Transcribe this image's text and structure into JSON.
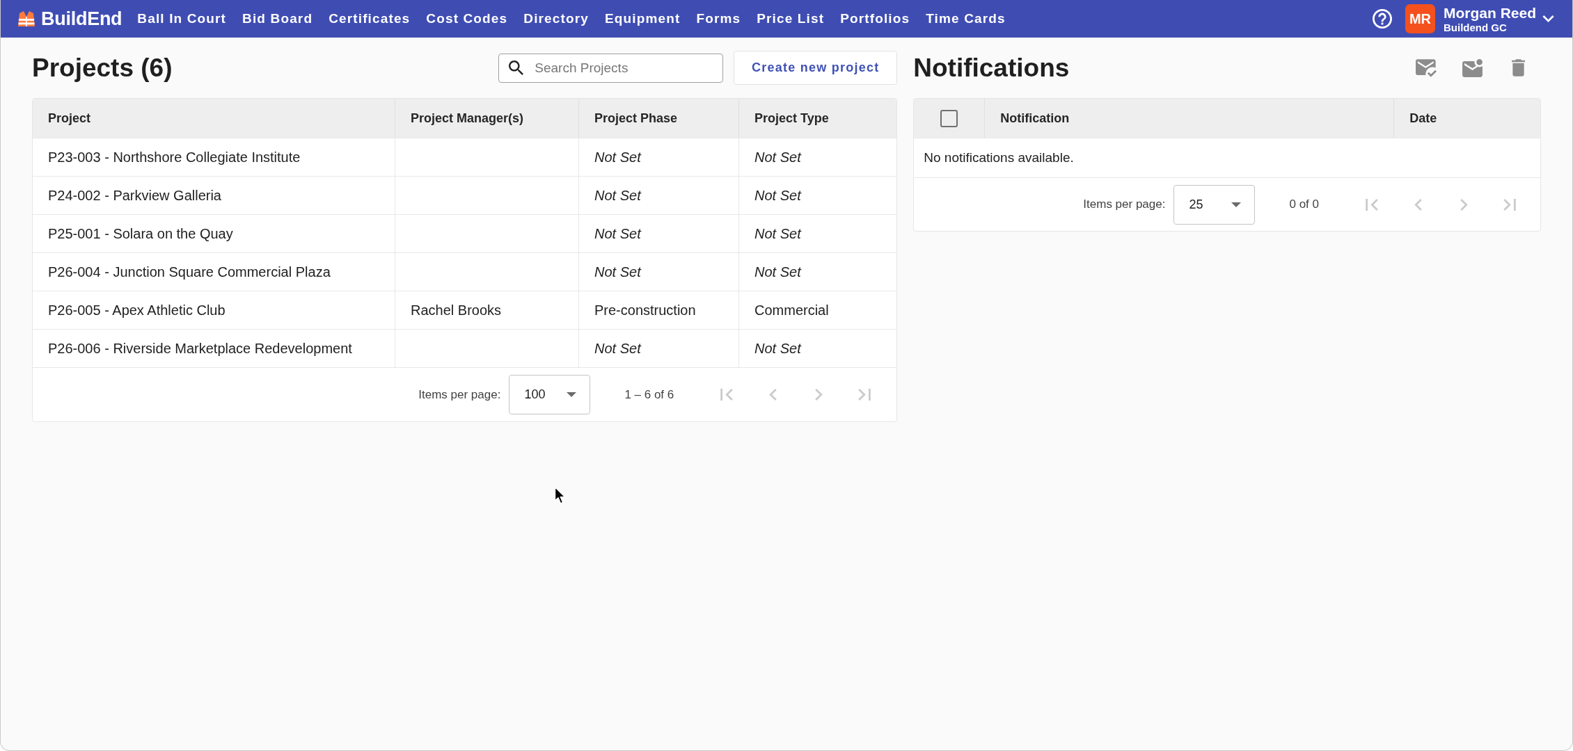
{
  "nav_bar": {
    "logo": "BuildEnd",
    "items": [
      "Ball In Court",
      "Bid Board",
      "Certificates",
      "Cost Codes",
      "Directory",
      "Equipment",
      "Forms",
      "Price List",
      "Portfolios",
      "Time Cards"
    ],
    "user": {
      "initials": "MR",
      "name": "Morgan Reed",
      "company": "Buildend GC"
    }
  },
  "projects": {
    "title": "Projects (6)",
    "search": {
      "placeholder": "Search Projects"
    },
    "create_button": "Create new project",
    "table": {
      "columns": [
        "Project",
        "Project Manager(s)",
        "Project Phase",
        "Project Type"
      ],
      "rows": [
        {
          "project": "P23-003 - Northshore Collegiate Institute",
          "phase": {
            "text": "Not Set",
            "set": false
          },
          "type": {
            "text": "Not Set",
            "set": false
          }
        },
        {
          "project": "P24-002 - Parkview Galleria",
          "phase": {
            "text": "Not Set",
            "set": false
          },
          "type": {
            "text": "Not Set",
            "set": false
          }
        },
        {
          "project": "P25-001 - Solara on the Quay",
          "phase": {
            "text": "Not Set",
            "set": false
          },
          "type": {
            "text": "Not Set",
            "set": false
          }
        },
        {
          "project": "P26-004 - Junction Square Commercial Plaza",
          "phase": {
            "text": "Not Set",
            "set": false
          },
          "type": {
            "text": "Not Set",
            "set": false
          }
        },
        {
          "project": "P26-005 - Apex Athletic Club",
          "manager": "Rachel Brooks",
          "phase": {
            "text": "Pre-construction",
            "set": true
          },
          "type": {
            "text": "Commercial",
            "set": true
          }
        },
        {
          "project": "P26-006 - Riverside Marketplace Redevelopment",
          "phase": {
            "text": "Not Set",
            "set": false
          },
          "type": {
            "text": "Not Set",
            "set": false
          }
        }
      ]
    },
    "pagination": {
      "label": "Items per page:",
      "page_size": "100",
      "range": "1 – 6 of 6",
      "buttons": [
        {
          "kind": "first",
          "disabled": true
        },
        {
          "kind": "previous",
          "disabled": true
        },
        {
          "kind": "next",
          "disabled": true
        },
        {
          "kind": "last",
          "disabled": true
        }
      ]
    }
  },
  "notifications": {
    "title": "Notifications",
    "actions": [
      {
        "kind": "mark_read"
      },
      {
        "kind": "mark_unread"
      },
      {
        "kind": "delete"
      }
    ],
    "table": {
      "select_all": {
        "checked": false
      },
      "columns": [
        "Notification",
        "Date"
      ],
      "empty_message": "No notifications available."
    },
    "pagination": {
      "label": "Items per page:",
      "page_size": "25",
      "range": "0 of 0",
      "buttons": [
        {
          "kind": "first",
          "disabled": true
        },
        {
          "kind": "previous",
          "disabled": true
        },
        {
          "kind": "next",
          "disabled": true
        },
        {
          "kind": "last",
          "disabled": true
        }
      ]
    }
  }
}
